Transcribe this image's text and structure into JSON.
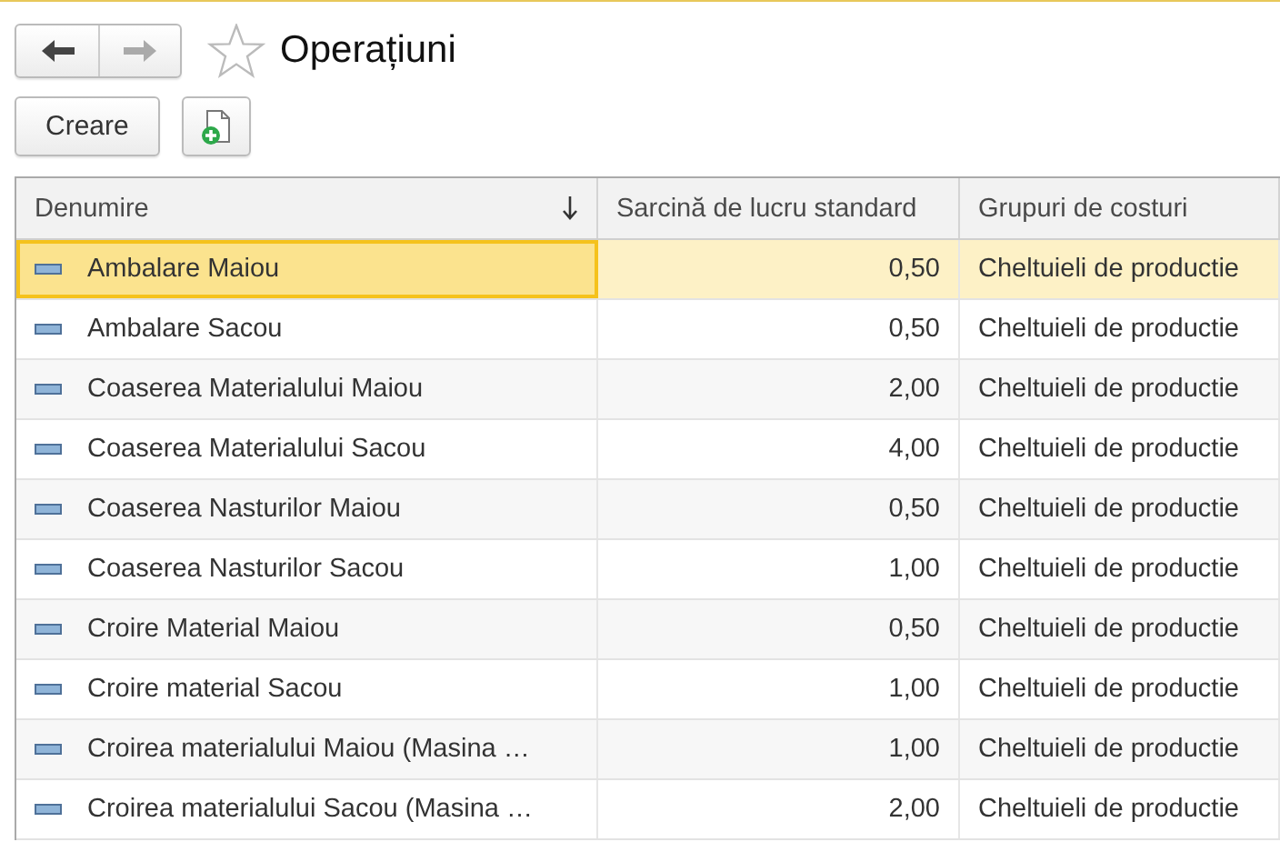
{
  "navigation": {
    "back_disabled": false,
    "forward_disabled": true
  },
  "favorite": false,
  "title": "Operațiuni",
  "toolbar": {
    "create_label": "Creare"
  },
  "table": {
    "columns": [
      {
        "label": "Denumire",
        "sorted": true
      },
      {
        "label": "Sarcină de lucru standard",
        "sorted": false
      },
      {
        "label": "Grupuri de costuri",
        "sorted": false
      }
    ],
    "rows": [
      {
        "name": "Ambalare Maiou",
        "workload": "0,50",
        "cost_group": "Cheltuieli de productie",
        "selected": true
      },
      {
        "name": "Ambalare Sacou",
        "workload": "0,50",
        "cost_group": "Cheltuieli de productie",
        "selected": false
      },
      {
        "name": "Coaserea Materialului Maiou",
        "workload": "2,00",
        "cost_group": "Cheltuieli de productie",
        "selected": false
      },
      {
        "name": "Coaserea Materialului Sacou",
        "workload": "4,00",
        "cost_group": "Cheltuieli de productie",
        "selected": false
      },
      {
        "name": "Coaserea Nasturilor Maiou",
        "workload": "0,50",
        "cost_group": "Cheltuieli de productie",
        "selected": false
      },
      {
        "name": "Coaserea Nasturilor Sacou",
        "workload": "1,00",
        "cost_group": "Cheltuieli de productie",
        "selected": false
      },
      {
        "name": "Croire Material Maiou",
        "workload": "0,50",
        "cost_group": "Cheltuieli de productie",
        "selected": false
      },
      {
        "name": "Croire material Sacou",
        "workload": "1,00",
        "cost_group": "Cheltuieli de productie",
        "selected": false
      },
      {
        "name": "Croirea materialului Maiou (Masina …",
        "workload": "1,00",
        "cost_group": "Cheltuieli de productie",
        "selected": false
      },
      {
        "name": "Croirea materialului Sacou (Masina …",
        "workload": "2,00",
        "cost_group": "Cheltuieli de productie",
        "selected": false
      }
    ]
  }
}
